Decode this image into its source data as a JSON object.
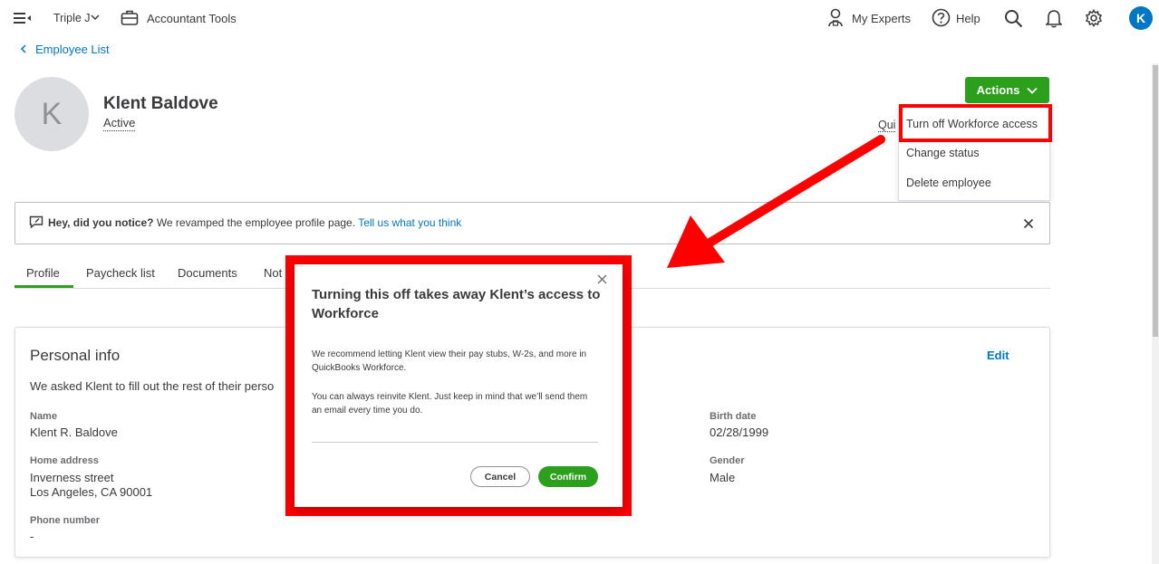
{
  "topbar": {
    "company": "Triple J",
    "accountant_tools": "Accountant Tools",
    "my_experts": "My Experts",
    "help": "Help",
    "user_initial": "K"
  },
  "breadcrumb": {
    "back_label": "Employee List"
  },
  "employee": {
    "initial": "K",
    "name": "Klent Baldove",
    "status": "Active",
    "truncated_link": "Qui"
  },
  "actions": {
    "label": "Actions",
    "menu": [
      "Turn off Workforce access",
      "Change status",
      "Delete employee"
    ]
  },
  "notice": {
    "bold": "Hey, did you notice?",
    "text": "We revamped the employee profile page.",
    "link": "Tell us what you think"
  },
  "tabs": [
    "Profile",
    "Paycheck list",
    "Documents",
    "Not"
  ],
  "personal_info": {
    "title": "Personal info",
    "edit": "Edit",
    "intro": "We asked Klent to fill out the rest of their perso",
    "name_label": "Name",
    "name_value": "Klent R. Baldove",
    "address_label": "Home address",
    "address_line1": "Inverness street",
    "address_line2": "Los Angeles, CA 90001",
    "phone_label": "Phone number",
    "phone_value": "-",
    "birth_label": "Birth date",
    "birth_value": "02/28/1999",
    "gender_label": "Gender",
    "gender_value": "Male"
  },
  "modal": {
    "title": "Turning this off takes away Klent’s access to Workforce",
    "para1": "We recommend letting Klent view their pay stubs, W-2s, and more in QuickBooks Workforce.",
    "para2": "You can always reinvite Klent. Just keep in mind that we’ll send them an email every time you do.",
    "cancel": "Cancel",
    "confirm": "Confirm"
  },
  "colors": {
    "brand_green": "#2ca01c",
    "link_blue": "#0077c5",
    "annotation_red": "#ff0000"
  },
  "icons": [
    "hamburger-menu-icon",
    "chevron-down-icon",
    "briefcase-icon",
    "expert-person-icon",
    "help-circle-icon",
    "search-icon",
    "bell-icon",
    "gear-icon",
    "chevron-left-icon",
    "feedback-icon",
    "close-icon",
    "annotation-arrow"
  ]
}
